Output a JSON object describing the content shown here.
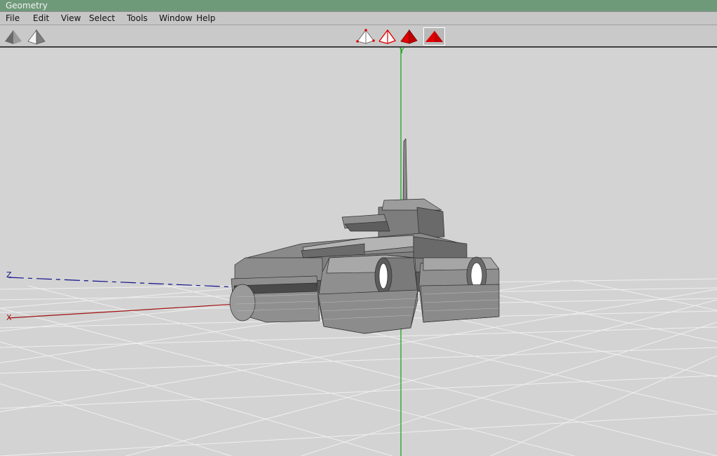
{
  "window": {
    "title": "Geometry"
  },
  "menu": [
    "File",
    "Edit",
    "View",
    "Select",
    "Tools",
    "Window",
    "Help"
  ],
  "toolbar": {
    "left_tools": [
      {
        "name": "shaded-pyramid-icon"
      },
      {
        "name": "lit-pyramid-icon"
      }
    ],
    "mode_tools": [
      {
        "name": "vertex-select-icon",
        "active": false
      },
      {
        "name": "edge-select-icon",
        "active": false
      },
      {
        "name": "face-select-icon",
        "active": false
      },
      {
        "name": "object-select-icon",
        "active": true
      }
    ]
  },
  "viewport": {
    "axes": {
      "x": "X",
      "y": "Y",
      "z": "Z"
    },
    "colors": {
      "x_axis": "#a01010",
      "y_axis": "#10a010",
      "z_axis": "#10108a",
      "grid": "#f0f0f0",
      "accent": "#e00000"
    }
  }
}
